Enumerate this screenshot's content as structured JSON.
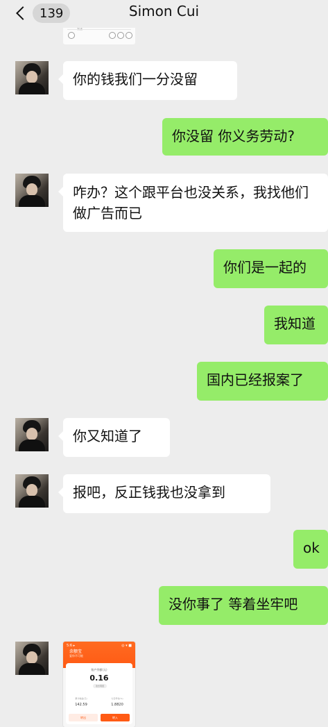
{
  "header": {
    "back_count": "139",
    "contact_name": "Simon Cui"
  },
  "top_preview": {
    "tiny_text": "发送"
  },
  "messages": [
    {
      "side": "left",
      "text": "你的钱我们一分没留"
    },
    {
      "side": "right",
      "text": "你没留 你义务劳动?"
    },
    {
      "side": "left",
      "text": "咋办？这个跟平台也没关系，我找他们做广告而已"
    },
    {
      "side": "right",
      "text": "你们是一起的"
    },
    {
      "side": "right",
      "text": "我知道"
    },
    {
      "side": "right",
      "text": "国内已经报案了"
    },
    {
      "side": "left",
      "text": "你又知道了"
    },
    {
      "side": "left",
      "text": "报吧，反正钱我也没拿到"
    },
    {
      "side": "right",
      "text": "ok"
    },
    {
      "side": "right",
      "text": "没你事了 等着坐牢吧"
    }
  ],
  "image_message": {
    "status_left": "5:6 ▸",
    "status_right": "◎ ▾ ■",
    "title": "余额宝",
    "subtitle": "爱你不可能",
    "balance_label": "账户余额(元)",
    "balance_value": "0.16",
    "pill_text": "收支明细",
    "left_label": "累计收益(元)",
    "right_label": "七日年化(%)",
    "left_value": "142.59",
    "right_value": "1.8820",
    "button_left": "转出",
    "button_right": "转入"
  }
}
